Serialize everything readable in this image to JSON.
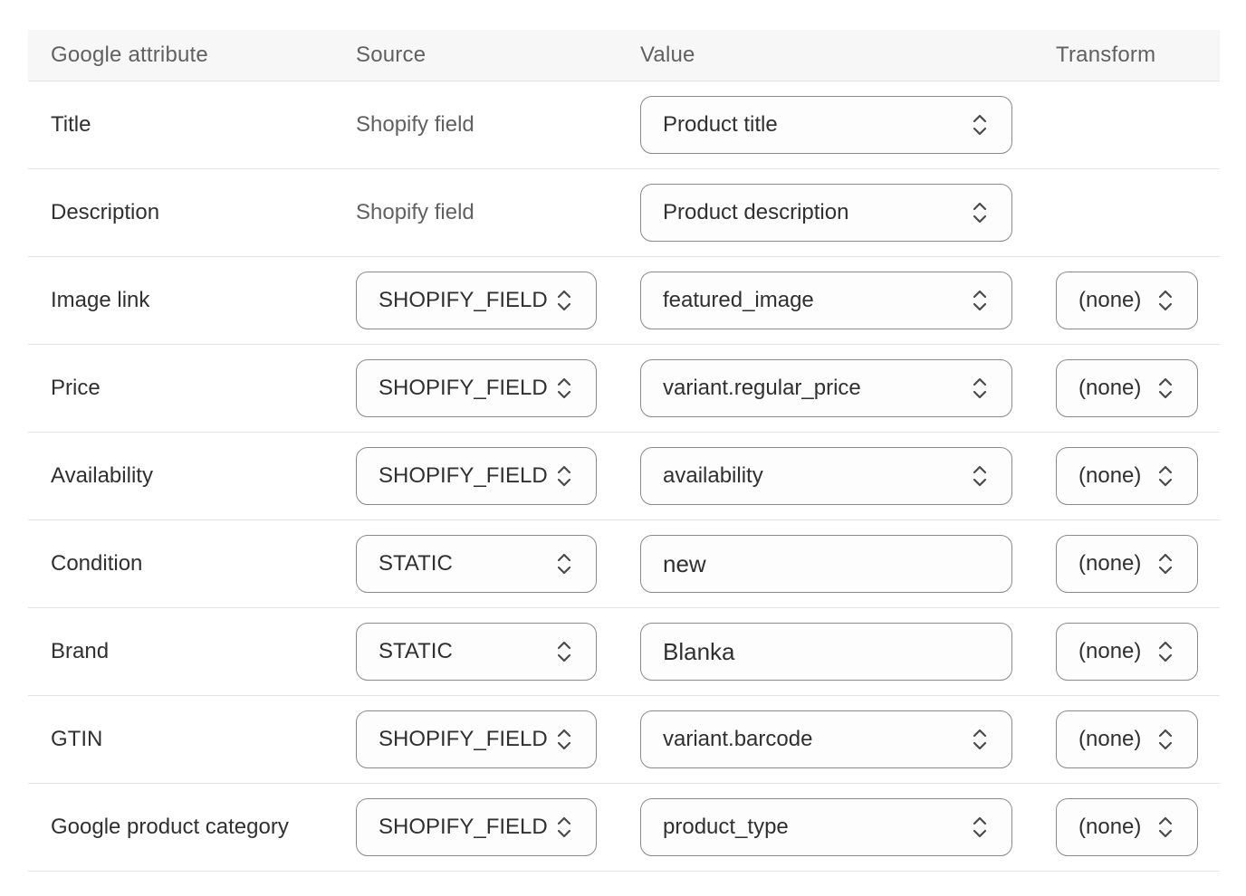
{
  "header": {
    "attribute": "Google attribute",
    "source": "Source",
    "value": "Value",
    "transform": "Transform"
  },
  "icons": {
    "select_chevron": "chevron-up-down-icon"
  },
  "rows": [
    {
      "attribute": "Title",
      "source_type": "text",
      "source": "Shopify field",
      "value_type": "select",
      "value": "Product title",
      "transform": ""
    },
    {
      "attribute": "Description",
      "source_type": "text",
      "source": "Shopify field",
      "value_type": "select",
      "value": "Product description",
      "transform": ""
    },
    {
      "attribute": "Image link",
      "source_type": "select",
      "source": "SHOPIFY_FIELD",
      "value_type": "select",
      "value": "featured_image",
      "transform": "(none)"
    },
    {
      "attribute": "Price",
      "source_type": "select",
      "source": "SHOPIFY_FIELD",
      "value_type": "select",
      "value": "variant.regular_price",
      "transform": "(none)"
    },
    {
      "attribute": "Availability",
      "source_type": "select",
      "source": "SHOPIFY_FIELD",
      "value_type": "select",
      "value": "availability",
      "transform": "(none)"
    },
    {
      "attribute": "Condition",
      "source_type": "select",
      "source": "STATIC",
      "value_type": "input",
      "value": "new",
      "transform": "(none)"
    },
    {
      "attribute": "Brand",
      "source_type": "select",
      "source": "STATIC",
      "value_type": "input",
      "value": "Blanka",
      "transform": "(none)"
    },
    {
      "attribute": "GTIN",
      "source_type": "select",
      "source": "SHOPIFY_FIELD",
      "value_type": "select",
      "value": "variant.barcode",
      "transform": "(none)"
    },
    {
      "attribute": "Google product category",
      "source_type": "select",
      "source": "SHOPIFY_FIELD",
      "value_type": "select",
      "value": "product_type",
      "transform": "(none)"
    }
  ]
}
